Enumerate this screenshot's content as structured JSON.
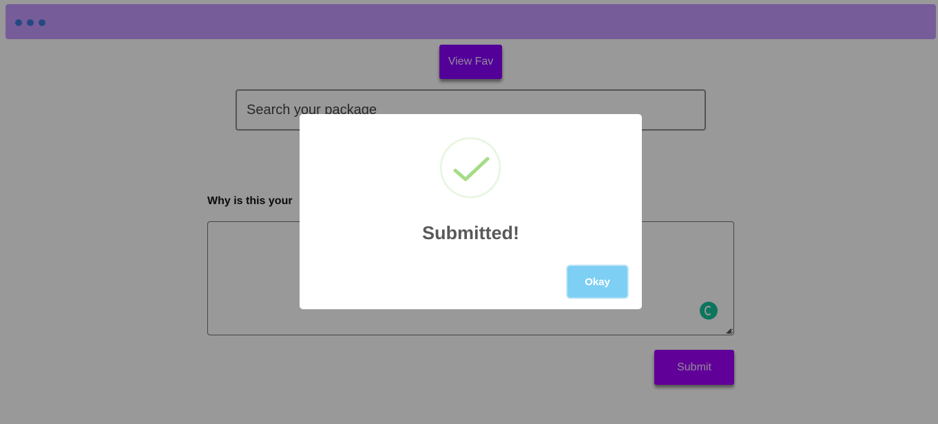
{
  "header": {
    "menu_icon": "three-dots-icon",
    "accent_color": "#c59bff"
  },
  "toolbar": {
    "view_fav_label": "View Fav"
  },
  "search": {
    "placeholder": "Search your package",
    "value": ""
  },
  "form": {
    "question_label": "Why is this your",
    "reason_value": "",
    "submit_label": "Submit",
    "assistant_icon": "grammarly-icon"
  },
  "modal": {
    "icon": "success-check-icon",
    "title": "Submitted!",
    "okay_label": "Okay",
    "check_color": "#a5dc86",
    "button_color": "#7ecff4"
  }
}
